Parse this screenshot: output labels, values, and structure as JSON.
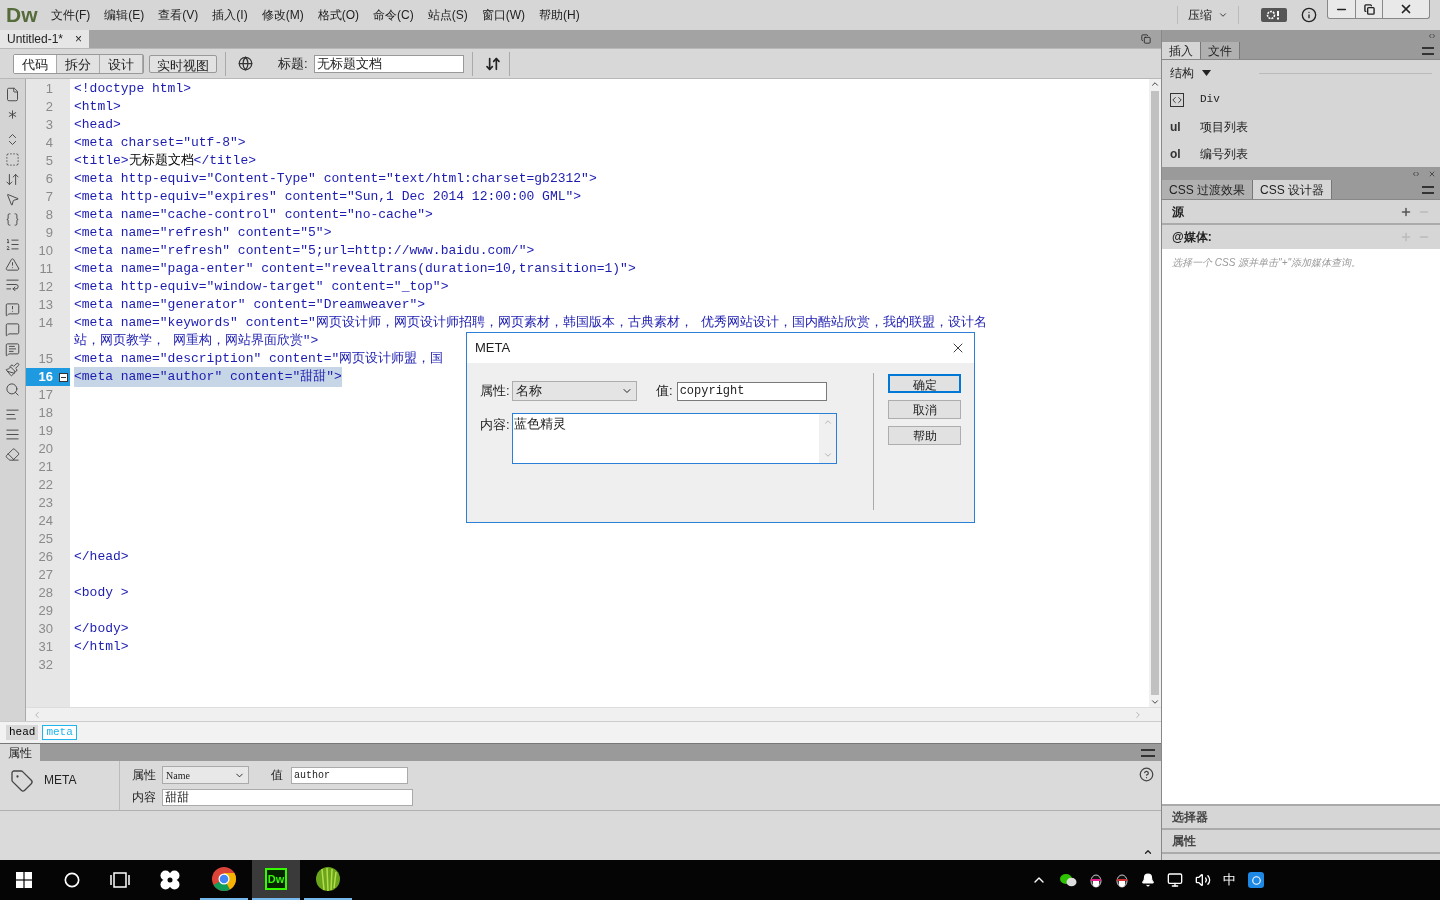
{
  "menu_bar": {
    "logo": "Dw",
    "items": [
      "文件(F)",
      "编辑(E)",
      "查看(V)",
      "插入(I)",
      "修改(M)",
      "格式(O)",
      "命令(C)",
      "站点(S)",
      "窗口(W)",
      "帮助(H)"
    ],
    "workspace": "压缩"
  },
  "document_tab": {
    "title": "Untitled-1*",
    "close": "×"
  },
  "toolbar": {
    "views": [
      {
        "label": "代码",
        "selected": true
      },
      {
        "label": "拆分",
        "selected": false
      },
      {
        "label": "设计",
        "selected": false
      },
      {
        "label": "实时视图",
        "selected": false
      }
    ],
    "title_label": "标题:",
    "title_value": "无标题文档"
  },
  "code": {
    "lines": [
      {
        "number": "1",
        "rows": [
          [
            {
              "kind": "code",
              "text": "<!doctype html>"
            }
          ]
        ]
      },
      {
        "number": "2",
        "rows": [
          [
            {
              "kind": "code",
              "text": "<html>"
            }
          ]
        ]
      },
      {
        "number": "3",
        "rows": [
          [
            {
              "kind": "code",
              "text": "<head>"
            }
          ]
        ]
      },
      {
        "number": "4",
        "rows": [
          [
            {
              "kind": "code",
              "text": "<meta charset=\"utf-8\">"
            }
          ]
        ]
      },
      {
        "number": "5",
        "rows": [
          [
            {
              "kind": "code",
              "text": "<title>"
            },
            {
              "kind": "text",
              "text": "无标题文档"
            },
            {
              "kind": "code",
              "text": "</title>"
            }
          ]
        ]
      },
      {
        "number": "6",
        "rows": [
          [
            {
              "kind": "code",
              "text": "<meta http-equiv=\"Content-Type\" content=\"text/html:charset=gb2312\">"
            }
          ]
        ]
      },
      {
        "number": "7",
        "rows": [
          [
            {
              "kind": "code",
              "text": "<meta http-equiv=\"expires\" content=\"Sun,1 Dec 2014 12:00:00 GML\">"
            }
          ]
        ]
      },
      {
        "number": "8",
        "rows": [
          [
            {
              "kind": "code",
              "text": "<meta name=\"cache-control\" content=\"no-cache\">"
            }
          ]
        ]
      },
      {
        "number": "9",
        "rows": [
          [
            {
              "kind": "code",
              "text": "<meta name=\"refresh\" content=\"5\">"
            }
          ]
        ]
      },
      {
        "number": "10",
        "rows": [
          [
            {
              "kind": "code",
              "text": "<meta name=\"refresh\" content=\"5;url=http://www.baidu.com/\">"
            }
          ]
        ]
      },
      {
        "number": "11",
        "rows": [
          [
            {
              "kind": "code",
              "text": "<meta name=\"paga-enter\" content=\"revealtrans(duration=10,transition=1)\">"
            }
          ]
        ]
      },
      {
        "number": "12",
        "rows": [
          [
            {
              "kind": "code",
              "text": "<meta http-equiv=\"window-target\" content=\"_top\">"
            }
          ]
        ]
      },
      {
        "number": "13",
        "rows": [
          [
            {
              "kind": "code",
              "text": "<meta name=\"generator\" content=\"Dreamweaver\">"
            }
          ]
        ]
      },
      {
        "number": "14",
        "rows": [
          [
            {
              "kind": "code",
              "text": "<meta name=\"keywords\" content=\"网页设计师，网页设计师招聘，网页素材，韩国版本，古典素材， 优秀网站设计，国内酷站欣赏，我的联盟，设计名"
            }
          ],
          [
            {
              "kind": "code",
              "text": "站，网页教学， 网重构，网站界面欣赏\">"
            }
          ]
        ]
      },
      {
        "number": "15",
        "rows": [
          [
            {
              "kind": "code",
              "text": "<meta name=\"description\" content=\"网页设计师盟，国"
            }
          ]
        ]
      },
      {
        "number": "16",
        "selected": true,
        "fold": true,
        "rows": [
          [
            {
              "kind": "code",
              "text": "<meta name=\"author\" content=\"甜甜\">"
            }
          ]
        ]
      },
      {
        "number": "17"
      },
      {
        "number": "18"
      },
      {
        "number": "19"
      },
      {
        "number": "20"
      },
      {
        "number": "21"
      },
      {
        "number": "22"
      },
      {
        "number": "23"
      },
      {
        "number": "24"
      },
      {
        "number": "25"
      },
      {
        "number": "26",
        "rows": [
          [
            {
              "kind": "code",
              "text": "</head>"
            }
          ]
        ]
      },
      {
        "number": "27"
      },
      {
        "number": "28",
        "rows": [
          [
            {
              "kind": "code",
              "text": "<body >"
            }
          ]
        ]
      },
      {
        "number": "29"
      },
      {
        "number": "30",
        "rows": [
          [
            {
              "kind": "code",
              "text": "</body>"
            }
          ]
        ]
      },
      {
        "number": "31",
        "rows": [
          [
            {
              "kind": "code",
              "text": "</html>"
            }
          ]
        ]
      },
      {
        "number": "32"
      }
    ]
  },
  "tag_selector": [
    {
      "label": "head",
      "selected": false
    },
    {
      "label": "meta",
      "selected": true
    }
  ],
  "properties": {
    "tab": "属性",
    "tag_name": "META",
    "attribute_label": "属性",
    "attribute": "Name",
    "value_label": "值",
    "value": "author",
    "content_label": "内容",
    "content": "甜甜"
  },
  "dialog": {
    "title": "META",
    "attribute_label": "属性:",
    "attribute": "名称",
    "value_label": "值:",
    "value": "copyright",
    "content_label": "内容:",
    "content": "蓝色精灵",
    "buttons": [
      {
        "label": "确定",
        "default": true
      },
      {
        "label": "取消",
        "default": false
      },
      {
        "label": "帮助",
        "default": false
      }
    ]
  },
  "insert_panel": {
    "tabs": [
      {
        "label": "插入",
        "selected": true
      },
      {
        "label": "文件",
        "selected": false
      }
    ],
    "category": "结构",
    "items": [
      {
        "kind": "icon",
        "label": "Div"
      },
      {
        "kind": "abbr",
        "abbr": "ul",
        "label": "项目列表"
      },
      {
        "kind": "abbr",
        "abbr": "ol",
        "label": "编号列表"
      }
    ]
  },
  "css_panel": {
    "tabs": [
      {
        "label": "CSS 过渡效果",
        "selected": false
      },
      {
        "label": "CSS 设计器",
        "selected": true
      }
    ],
    "sources": "源",
    "media": "@媒体:",
    "hint": "选择一个 CSS 源并单击\"+\"添加媒体查询。",
    "selectors": "选择器",
    "properties": "属性"
  },
  "taskbar": {
    "apps": [
      {
        "kind": "chrome",
        "active": false
      },
      {
        "kind": "dreamweaver",
        "label": "Dw",
        "active": true
      },
      {
        "kind": "green",
        "active": false
      }
    ],
    "ime": "中"
  }
}
